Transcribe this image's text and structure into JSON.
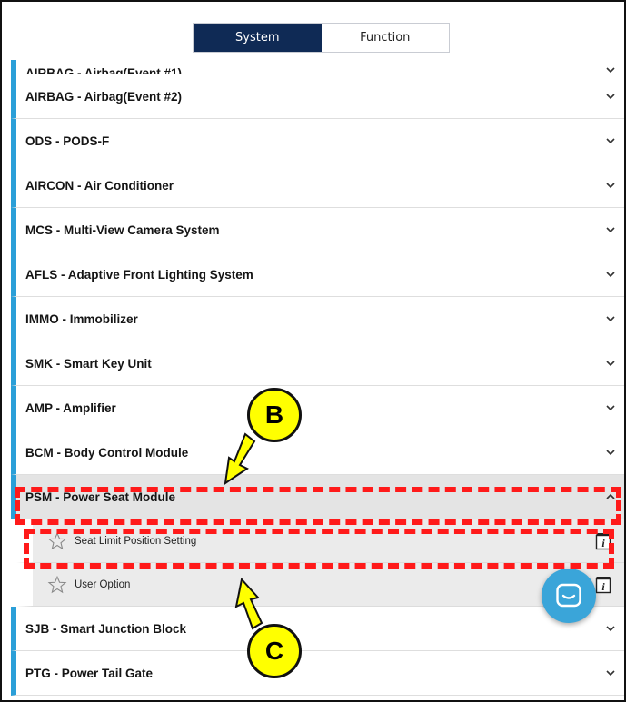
{
  "toggle": {
    "system_label": "System",
    "function_label": "Function",
    "active": "System"
  },
  "systems": [
    {
      "label": "AIRBAG - Airbag(Event #1)",
      "state": "partial"
    },
    {
      "label": "AIRBAG - Airbag(Event #2)",
      "state": "collapsed"
    },
    {
      "label": "ODS - PODS-F",
      "state": "collapsed"
    },
    {
      "label": "AIRCON - Air Conditioner",
      "state": "collapsed"
    },
    {
      "label": "MCS - Multi-View Camera System",
      "state": "collapsed"
    },
    {
      "label": "AFLS - Adaptive Front Lighting System",
      "state": "collapsed"
    },
    {
      "label": "IMMO - Immobilizer",
      "state": "collapsed"
    },
    {
      "label": "SMK - Smart Key Unit",
      "state": "collapsed"
    },
    {
      "label": "AMP - Amplifier",
      "state": "collapsed"
    },
    {
      "label": "BCM - Body Control Module",
      "state": "collapsed"
    },
    {
      "label": "PSM - Power Seat Module",
      "state": "expanded",
      "functions": [
        {
          "label": "Seat Limit Position Setting"
        },
        {
          "label": "User Option"
        }
      ]
    },
    {
      "label": "SJB - Smart Junction Block",
      "state": "collapsed"
    },
    {
      "label": "PTG - Power Tail Gate",
      "state": "collapsed"
    }
  ],
  "callouts": {
    "b": "B",
    "c": "C"
  },
  "icons": {
    "chevron": "chevron-icon",
    "star": "star-icon",
    "info": "info-icon",
    "chat": "chat-icon"
  },
  "colors": {
    "accent_bar": "#2b9fd8",
    "toggle_active": "#0f2a55",
    "chat_button": "#3aa5d9",
    "callout_fill": "#ffff00",
    "highlight_dash": "#ff1a1a"
  }
}
